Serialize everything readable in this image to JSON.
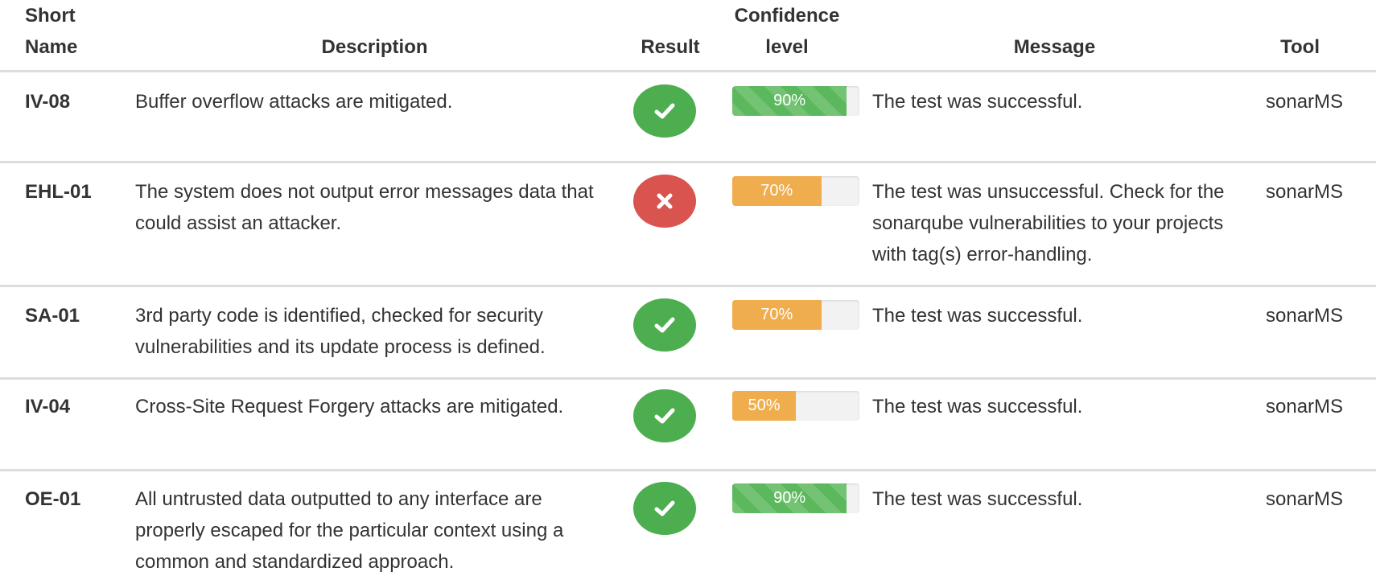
{
  "table": {
    "headers": {
      "short_name_line1": "Short",
      "short_name_line2": "Name",
      "description": "Description",
      "result": "Result",
      "confidence_line1": "Confidence",
      "confidence_line2": "level",
      "message": "Message",
      "tool": "Tool"
    },
    "rows": [
      {
        "short_name": "IV-08",
        "description": "Buffer overflow attacks are mitigated.",
        "result": "pass",
        "result_icon": "check-icon",
        "confidence": 0.9,
        "confidence_label": "90%",
        "confidence_color": "#5cb85c",
        "message": "The test was successful.",
        "tool": "sonarMS"
      },
      {
        "short_name": "EHL-01",
        "description": "The system does not output error messages data that could assist an attacker.",
        "result": "fail",
        "result_icon": "x-icon",
        "confidence": 0.7,
        "confidence_label": "70%",
        "confidence_color": "#f0ad4e",
        "message": "The test was unsuccessful. Check for the sonarqube vulnerabilities to your projects with tag(s) error-handling.",
        "tool": "sonarMS"
      },
      {
        "short_name": "SA-01",
        "description": "3rd party code is identified, checked for security vulnerabilities and its update process is defined.",
        "result": "pass",
        "result_icon": "check-icon",
        "confidence": 0.7,
        "confidence_label": "70%",
        "confidence_color": "#f0ad4e",
        "message": "The test was successful.",
        "tool": "sonarMS"
      },
      {
        "short_name": "IV-04",
        "description": "Cross-Site Request Forgery attacks are mitigated.",
        "result": "pass",
        "result_icon": "check-icon",
        "confidence": 0.5,
        "confidence_label": "50%",
        "confidence_color": "#f0ad4e",
        "message": "The test was successful.",
        "tool": "sonarMS"
      },
      {
        "short_name": "OE-01",
        "description": "All untrusted data outputted to any interface are properly escaped for the particular context using a common and standardized approach.",
        "result": "pass",
        "result_icon": "check-icon",
        "confidence": 0.9,
        "confidence_label": "90%",
        "confidence_color": "#5cb85c",
        "message": "The test was successful.",
        "tool": "sonarMS"
      }
    ]
  },
  "colors": {
    "pass": "#4cae4f",
    "fail": "#d9534f",
    "progress_green": "#5cb85c",
    "progress_orange": "#f0ad4e"
  }
}
